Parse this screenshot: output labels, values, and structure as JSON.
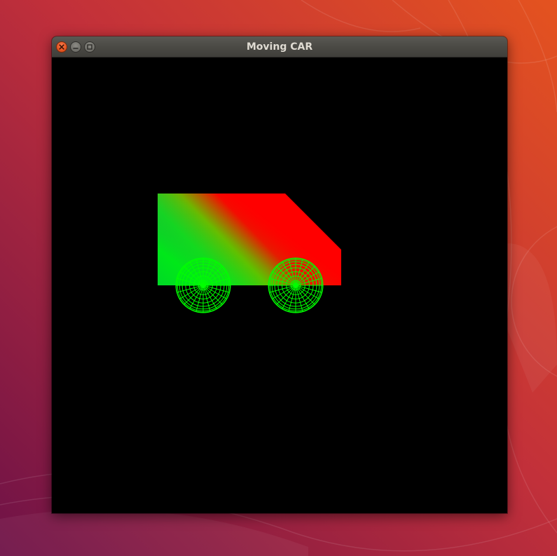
{
  "window": {
    "title": "Moving CAR",
    "buttons": {
      "close": "close-icon",
      "minimize": "minimize-icon",
      "maximize": "maximize-icon"
    }
  },
  "scene": {
    "background_color": "#000000",
    "car_body_gradient": [
      "#ff0000",
      "#00ff00",
      "#0000ff"
    ],
    "wheel_color": "#00ff00",
    "wheel_style": "wireframe sphere"
  },
  "desktop": {
    "theme_colors": [
      "#e24b22",
      "#b52a3c",
      "#7a1548"
    ]
  }
}
